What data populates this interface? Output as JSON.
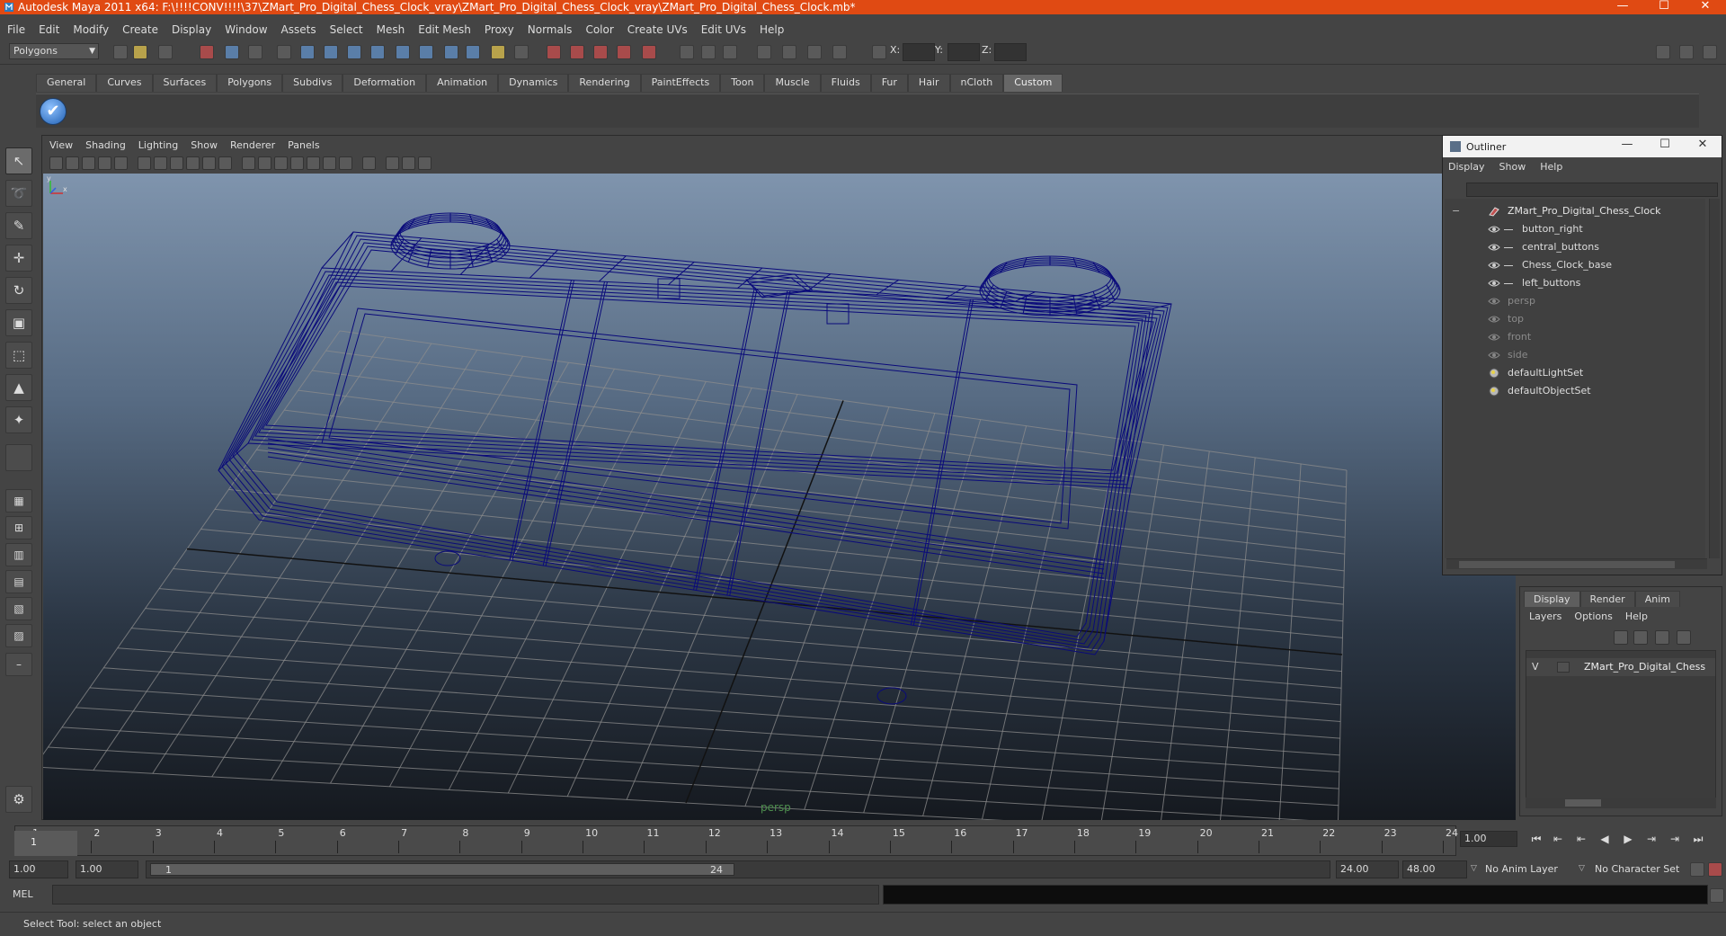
{
  "window": {
    "title": "Autodesk Maya 2011 x64: F:\\!!!!CONV!!!!\\37\\ZMart_Pro_Digital_Chess_Clock_vray\\ZMart_Pro_Digital_Chess_Clock_vray\\ZMart_Pro_Digital_Chess_Clock.mb*",
    "minimize": "—",
    "maximize": "☐",
    "close": "✕"
  },
  "menubar": [
    "File",
    "Edit",
    "Modify",
    "Create",
    "Display",
    "Window",
    "Assets",
    "Select",
    "Mesh",
    "Edit Mesh",
    "Proxy",
    "Normals",
    "Color",
    "Create UVs",
    "Edit UVs",
    "Help"
  ],
  "statusline": {
    "mode": "Polygons",
    "mode_arrow": "▼",
    "x_label": "X:",
    "y_label": "Y:",
    "z_label": "Z:"
  },
  "shelf": {
    "tabs": [
      "General",
      "Curves",
      "Surfaces",
      "Polygons",
      "Subdivs",
      "Deformation",
      "Animation",
      "Dynamics",
      "Rendering",
      "PaintEffects",
      "Toon",
      "Muscle",
      "Fluids",
      "Fur",
      "Hair",
      "nCloth",
      "Custom"
    ],
    "active_tab": "Custom",
    "check_icon": "✔"
  },
  "viewport": {
    "menu": [
      "View",
      "Shading",
      "Lighting",
      "Show",
      "Renderer",
      "Panels"
    ],
    "camera_label": "persp",
    "axis_x": "x",
    "axis_y": "y"
  },
  "outliner": {
    "title": "Outliner",
    "menu": [
      "Display",
      "Show",
      "Help"
    ],
    "collapse_symbol": "−",
    "items": [
      {
        "label": "ZMart_Pro_Digital_Chess_Clock",
        "level": 0,
        "kind": "root"
      },
      {
        "label": "button_right",
        "level": 1,
        "kind": "mesh"
      },
      {
        "label": "central_buttons",
        "level": 1,
        "kind": "mesh"
      },
      {
        "label": "Chess_Clock_base",
        "level": 1,
        "kind": "mesh"
      },
      {
        "label": "left_buttons",
        "level": 1,
        "kind": "mesh"
      },
      {
        "label": "persp",
        "level": 0,
        "kind": "camera"
      },
      {
        "label": "top",
        "level": 0,
        "kind": "camera"
      },
      {
        "label": "front",
        "level": 0,
        "kind": "camera"
      },
      {
        "label": "side",
        "level": 0,
        "kind": "camera"
      },
      {
        "label": "defaultLightSet",
        "level": 0,
        "kind": "set"
      },
      {
        "label": "defaultObjectSet",
        "level": 0,
        "kind": "set"
      }
    ]
  },
  "layers": {
    "tabs": [
      "Display",
      "Render",
      "Anim"
    ],
    "active_tab": "Display",
    "menu": [
      "Layers",
      "Options",
      "Help"
    ],
    "rows": [
      {
        "visible": "V",
        "name": "ZMart_Pro_Digital_Chess"
      }
    ]
  },
  "timeline": {
    "labels": [
      "1",
      "2",
      "3",
      "4",
      "5",
      "6",
      "7",
      "8",
      "9",
      "10",
      "11",
      "12",
      "13",
      "14",
      "15",
      "16",
      "17",
      "18",
      "19",
      "20",
      "21",
      "22",
      "23",
      "24"
    ],
    "current_frame": "1",
    "current_frame_field": "1.00",
    "playback": {
      "go_start": "⏮",
      "step_back": "⇤",
      "prev_key": "⇤",
      "play_back": "◀",
      "play_fwd": "▶",
      "next_key": "⇥",
      "step_fwd": "⇥",
      "go_end": "⏭"
    }
  },
  "range": {
    "start": "1.00",
    "playback_start": "1.00",
    "slider_start": "1",
    "slider_end": "24",
    "playback_end": "24.00",
    "end": "48.00",
    "anim_layer": "No Anim Layer",
    "character_set": "No Character Set",
    "dd_arrow": "▽"
  },
  "command": {
    "label": "MEL"
  },
  "help": {
    "text": "Select Tool: select an object"
  },
  "colors": {
    "titlebar": "#e04a13",
    "wireframe": "#0a0a7a",
    "grid": "#8d8d8d"
  }
}
